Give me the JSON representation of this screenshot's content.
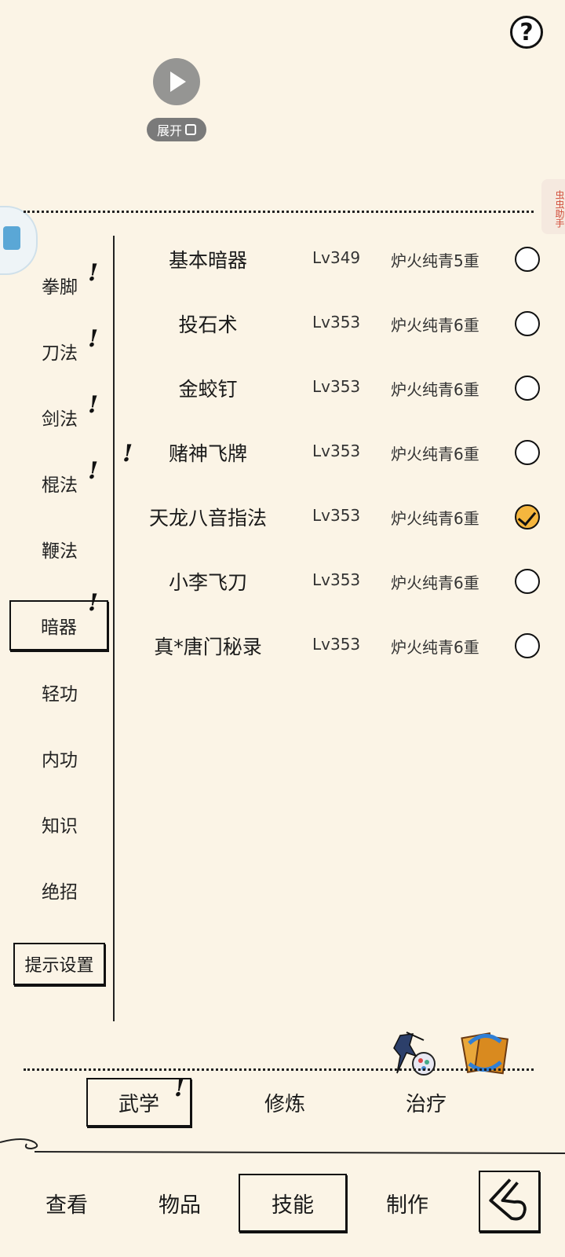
{
  "widget": {
    "expand_label": "展开"
  },
  "help_label": "?",
  "helper_tag": "虫虫助手",
  "categories": [
    {
      "label": "拳脚",
      "alert": "!"
    },
    {
      "label": "刀法",
      "alert": "!"
    },
    {
      "label": "剑法",
      "alert": "!"
    },
    {
      "label": "棍法",
      "alert": "!"
    },
    {
      "label": "鞭法",
      "alert": ""
    },
    {
      "label": "暗器",
      "alert": "!"
    },
    {
      "label": "轻功",
      "alert": ""
    },
    {
      "label": "内功",
      "alert": ""
    },
    {
      "label": "知识",
      "alert": ""
    },
    {
      "label": "绝招",
      "alert": ""
    }
  ],
  "hint_settings": "提示设置",
  "skills": [
    {
      "name": "基本暗器",
      "level": "Lv349",
      "realm": "炉火纯青5重",
      "checked": false
    },
    {
      "name": "投石术",
      "level": "Lv353",
      "realm": "炉火纯青6重",
      "checked": false
    },
    {
      "name": "金蛟钉",
      "level": "Lv353",
      "realm": "炉火纯青6重",
      "checked": false
    },
    {
      "name": "赌神飞牌",
      "level": "Lv353",
      "realm": "炉火纯青6重",
      "checked": false
    },
    {
      "name": "天龙八音指法",
      "level": "Lv353",
      "realm": "炉火纯青6重",
      "checked": true
    },
    {
      "name": "小李飞刀",
      "level": "Lv353",
      "realm": "炉火纯青6重",
      "checked": false
    },
    {
      "name": "真*唐门秘录",
      "level": "Lv353",
      "realm": "炉火纯青6重",
      "checked": false
    }
  ],
  "skill_alert": "!",
  "subtabs": [
    {
      "label": "武学",
      "alert": "!"
    },
    {
      "label": "修炼",
      "alert": ""
    },
    {
      "label": "治疗",
      "alert": ""
    }
  ],
  "nav": [
    {
      "label": "查看"
    },
    {
      "label": "物品"
    },
    {
      "label": "技能"
    },
    {
      "label": "制作"
    }
  ],
  "colors": {
    "background": "#fbf4e6",
    "checked": "#f5b63e",
    "helper_text": "#d24d3a"
  }
}
